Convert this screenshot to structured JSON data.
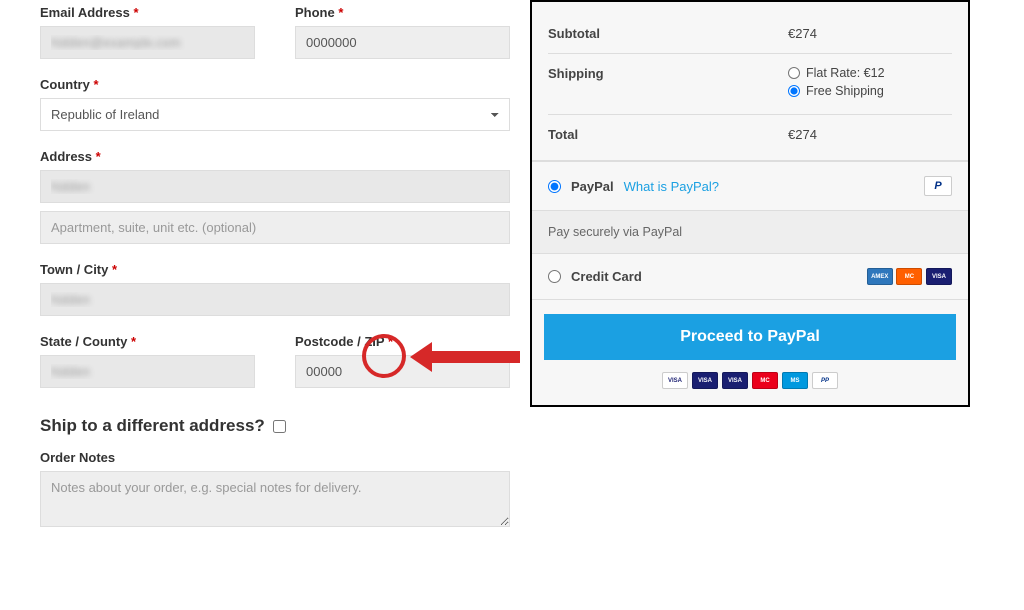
{
  "form": {
    "email_label": "Email Address",
    "email_value": "hidden@example.com",
    "phone_label": "Phone",
    "phone_value": "0000000",
    "country_label": "Country",
    "country_value": "Republic of Ireland",
    "address_label": "Address",
    "address_value": "hidden",
    "address2_placeholder": "Apartment, suite, unit etc. (optional)",
    "city_label": "Town / City",
    "city_value": "hidden",
    "state_label": "State / County",
    "state_value": "hidden",
    "postcode_label": "Postcode / ZIP",
    "postcode_value": "00000",
    "ship_diff_label": "Ship to a different address?",
    "notes_label": "Order Notes",
    "notes_placeholder": "Notes about your order, e.g. special notes for delivery."
  },
  "summary": {
    "subtotal_label": "Subtotal",
    "subtotal_value": "€274",
    "shipping_label": "Shipping",
    "shipping_options": [
      {
        "label": "Flat Rate: €12",
        "checked": false
      },
      {
        "label": "Free Shipping",
        "checked": true
      }
    ],
    "total_label": "Total",
    "total_value": "€274"
  },
  "payment": {
    "paypal_label": "PayPal",
    "paypal_what": "What is PayPal?",
    "paypal_desc": "Pay securely via PayPal",
    "cc_label": "Credit Card",
    "proceed_label": "Proceed to PayPal"
  },
  "card_brands": {
    "visa": "VISA",
    "visa_debit": "VISA",
    "visa_electron": "VISA",
    "mastercard": "MC",
    "maestro": "MS",
    "paypal": "PP",
    "amex": "AMEX"
  }
}
